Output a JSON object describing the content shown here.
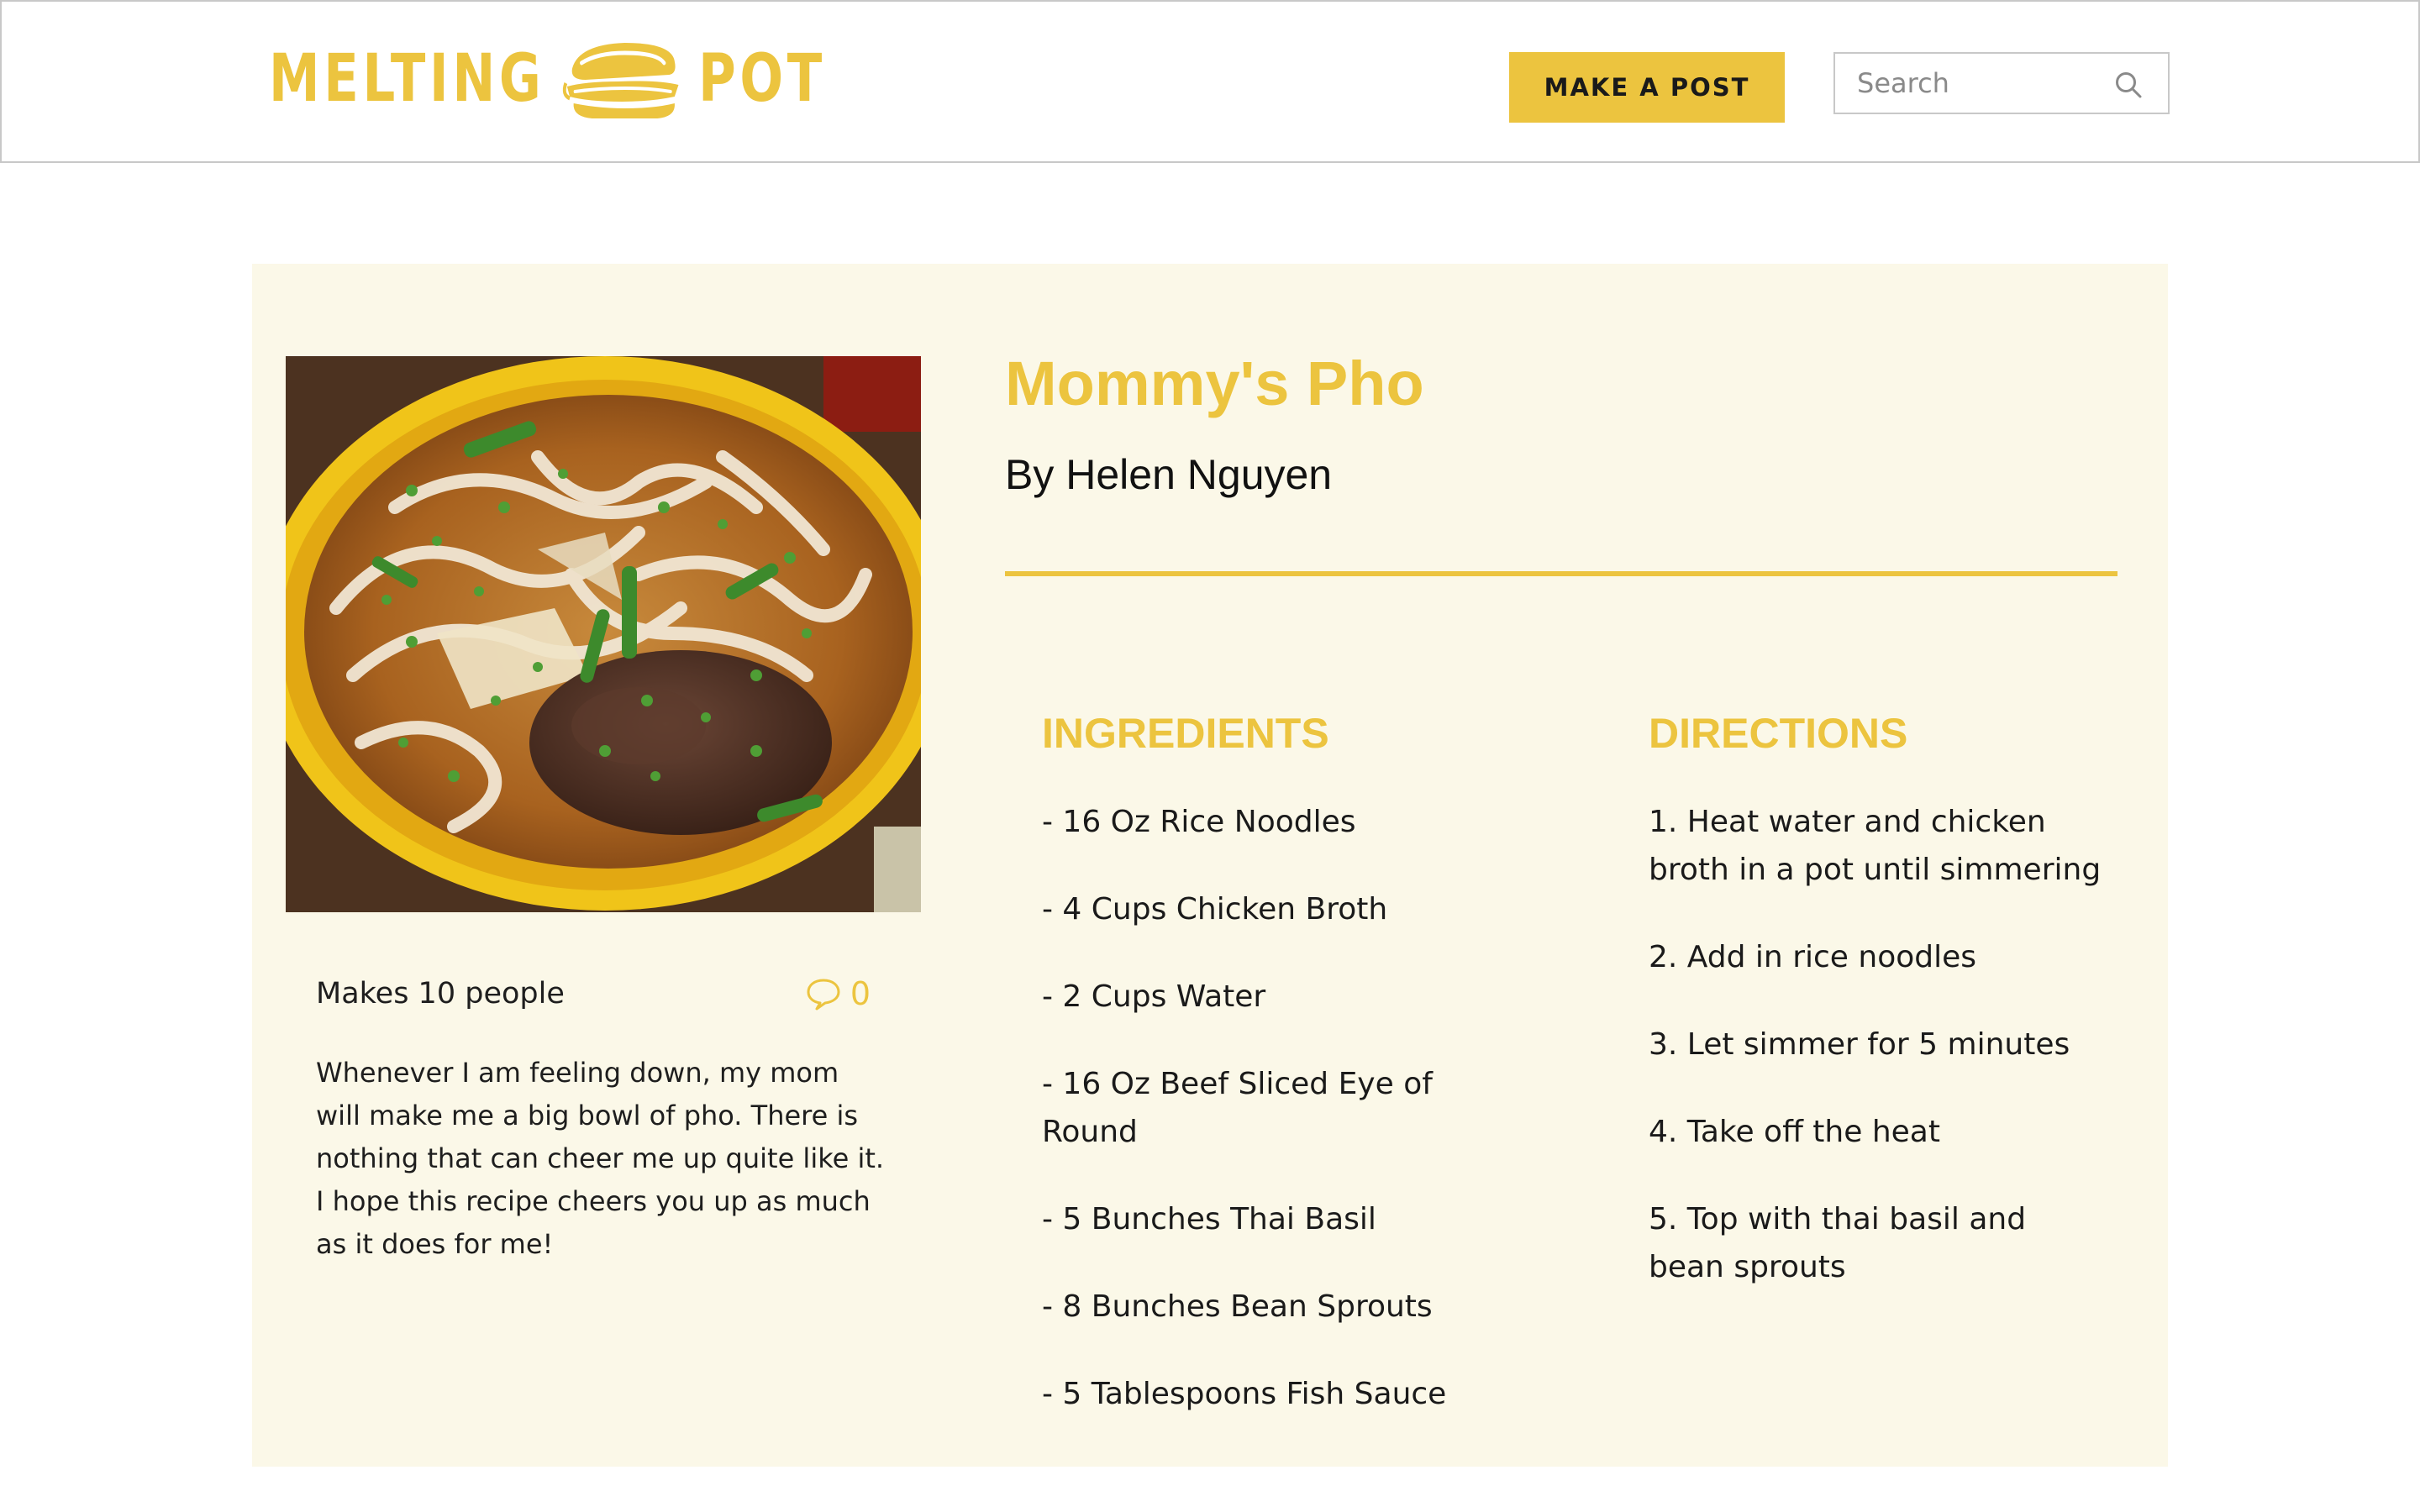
{
  "header": {
    "logo": {
      "word_left": "MELTING",
      "word_right": "POT",
      "icon": "sandwich-icon"
    },
    "make_post_label": "MAKE A POST",
    "search": {
      "placeholder": "Search",
      "value": "",
      "icon": "search-icon"
    }
  },
  "recipe": {
    "title": "Mommy's Pho",
    "author": "By Helen Nguyen",
    "photo": {
      "icon": "pho-bowl-photo"
    },
    "servings": "Makes 10 people",
    "comment_count": "0",
    "comment_icon": "speech-bubble-icon",
    "description": "Whenever I am feeling down, my mom will make me a big bowl of pho. There is nothing that can cheer me up quite like it. I hope this recipe cheers you up as much as it does for me!",
    "ingredients_heading": "INGREDIENTS",
    "ingredients": [
      "- 16 Oz Rice Noodles",
      "- 4 Cups Chicken Broth",
      "- 2 Cups Water",
      "- 16 Oz Beef Sliced Eye of Round",
      "- 5 Bunches Thai Basil",
      "- 8 Bunches Bean Sprouts",
      "- 5 Tablespoons Fish Sauce"
    ],
    "directions_heading": "DIRECTIONS",
    "directions": [
      "1. Heat water and chicken broth in a pot until simmering",
      "2. Add in rice noodles",
      "3. Let simmer for 5 minutes",
      "4. Take off the heat",
      "5. Top with thai basil and bean sprouts"
    ]
  },
  "colors": {
    "accent": "#ecc43f",
    "card_background": "#fbf8e8",
    "text": "#1a1a1a",
    "border": "#c8c8c8"
  }
}
